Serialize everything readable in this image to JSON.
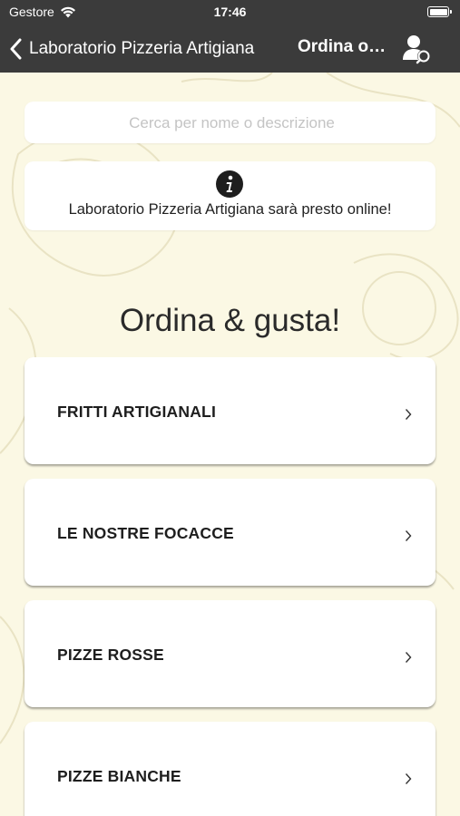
{
  "status_bar": {
    "carrier": "Gestore",
    "time": "17:46"
  },
  "nav": {
    "back_label": "Laboratorio Pizzeria Artigiana",
    "title": "Ordina online"
  },
  "search": {
    "placeholder": "Cerca per nome o descrizione",
    "value": ""
  },
  "info": {
    "message": "Laboratorio Pizzeria Artigiana sarà presto online!"
  },
  "section_title": "Ordina & gusta!",
  "categories": [
    {
      "label": "FRITTI ARTIGIANALI"
    },
    {
      "label": "LE NOSTRE FOCACCE"
    },
    {
      "label": "PIZZE ROSSE"
    },
    {
      "label": "PIZZE BIANCHE"
    }
  ],
  "colors": {
    "bar_background": "#3b3b3b",
    "page_background": "#fbf8e4",
    "card_background": "#ffffff",
    "text_primary": "#1e1e1e"
  },
  "icons": [
    "wifi-icon",
    "battery-icon",
    "back-chevron-icon",
    "user-key-icon",
    "info-icon",
    "chevron-right-icon"
  ]
}
